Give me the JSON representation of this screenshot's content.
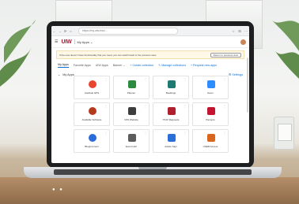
{
  "browser": {
    "url": "https://my.uiw.edu/...",
    "nav": [
      "←",
      "→",
      "⟳",
      "⌂"
    ],
    "toolbar_icons": [
      "☆",
      "⊞",
      "⋯"
    ]
  },
  "header": {
    "logo": "UIW",
    "title": "My Apps ⌄"
  },
  "banner": {
    "text": "If the new doesn't have functionality that you need, you can switch back to the previous view.",
    "button": "Return to previous view"
  },
  "tabs": [
    {
      "label": "My Apps",
      "active": true
    },
    {
      "label": "Favorite Apps"
    },
    {
      "label": "UIW Apps"
    },
    {
      "label": "Banner ⌄"
    }
  ],
  "actions": [
    "+ Create collection",
    "✎ Manage collections",
    "+ Request new apps"
  ],
  "section": {
    "title": "My Apps",
    "settings": "⚙ Settings"
  },
  "apps": [
    {
      "label": "Cardinal GPS",
      "color": "#e8462f",
      "icon": "target-icon"
    },
    {
      "label": "Planner",
      "color": "#2a8a3d",
      "icon": "planner-icon"
    },
    {
      "label": "Bookings",
      "color": "#1d7a73",
      "icon": "bookings-icon"
    },
    {
      "label": "Zoom",
      "color": "#2d8cff",
      "icon": "video-icon"
    },
    {
      "label": "Available Software",
      "color": "#b33a1c",
      "icon": "software-icon"
    },
    {
      "label": "UIW Website",
      "color": "#3d3d3d",
      "icon": "website-icon"
    },
    {
      "label": "IT/AV Requests",
      "color": "#b11f2f",
      "icon": "requests-icon"
    },
    {
      "label": "Panopto",
      "color": "#c4142f",
      "icon": "play-icon"
    },
    {
      "label": "BlogConnect",
      "color": "#2b6bd9",
      "icon": "blog-icon"
    },
    {
      "label": "Event Hub",
      "color": "#5c5c5c",
      "icon": "event-icon"
    },
    {
      "label": "Adobe Sign",
      "color": "#2a6fd6",
      "icon": "sign-icon"
    },
    {
      "label": "USER Access",
      "color": "#d9661c",
      "icon": "user-icon"
    }
  ]
}
